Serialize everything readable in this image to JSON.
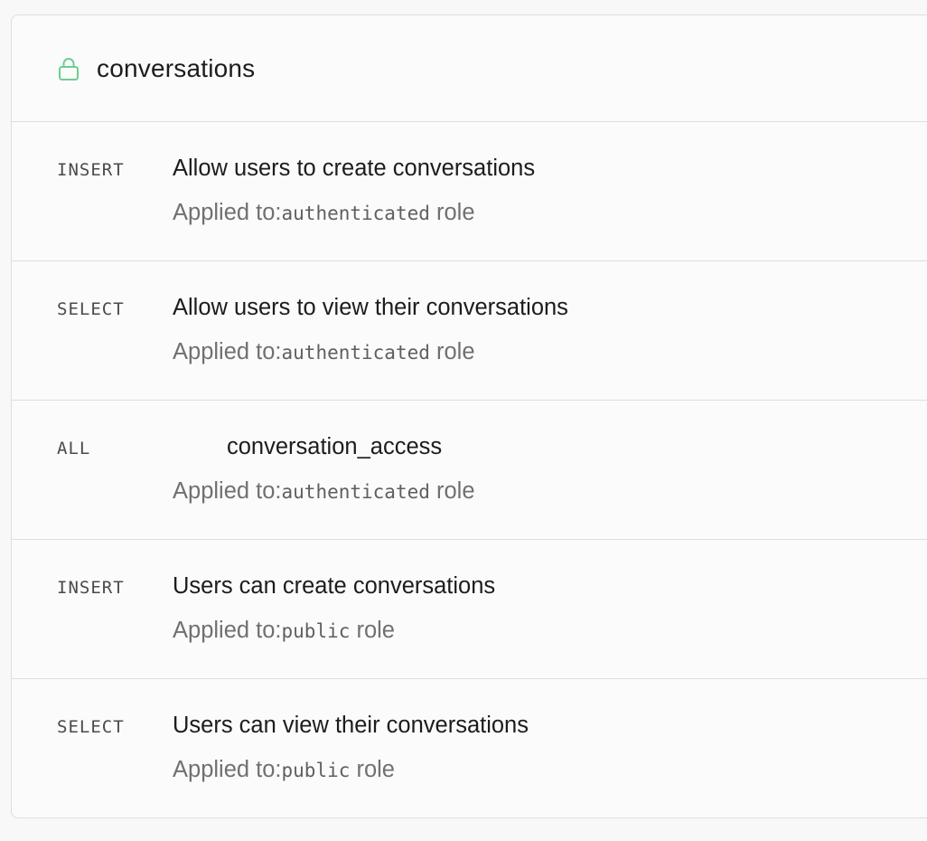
{
  "table": {
    "name": "conversations",
    "icon": "lock-icon",
    "icon_color": "#6ccf8e"
  },
  "policies": [
    {
      "command": "INSERT",
      "name": "Allow users to create conversations",
      "applied_prefix": "Applied to:",
      "role": "authenticated",
      "role_suffix": " role"
    },
    {
      "command": "SELECT",
      "name": "Allow users to view their conversations",
      "applied_prefix": "Applied to:",
      "role": "authenticated",
      "role_suffix": " role"
    },
    {
      "command": "ALL",
      "name": "conversation_access",
      "applied_prefix": "Applied to:",
      "role": "authenticated",
      "role_suffix": " role"
    },
    {
      "command": "INSERT",
      "name": "Users can create conversations",
      "applied_prefix": "Applied to:",
      "role": "public",
      "role_suffix": " role"
    },
    {
      "command": "SELECT",
      "name": "Users can view their conversations",
      "applied_prefix": "Applied to:",
      "role": "public",
      "role_suffix": " role"
    }
  ]
}
